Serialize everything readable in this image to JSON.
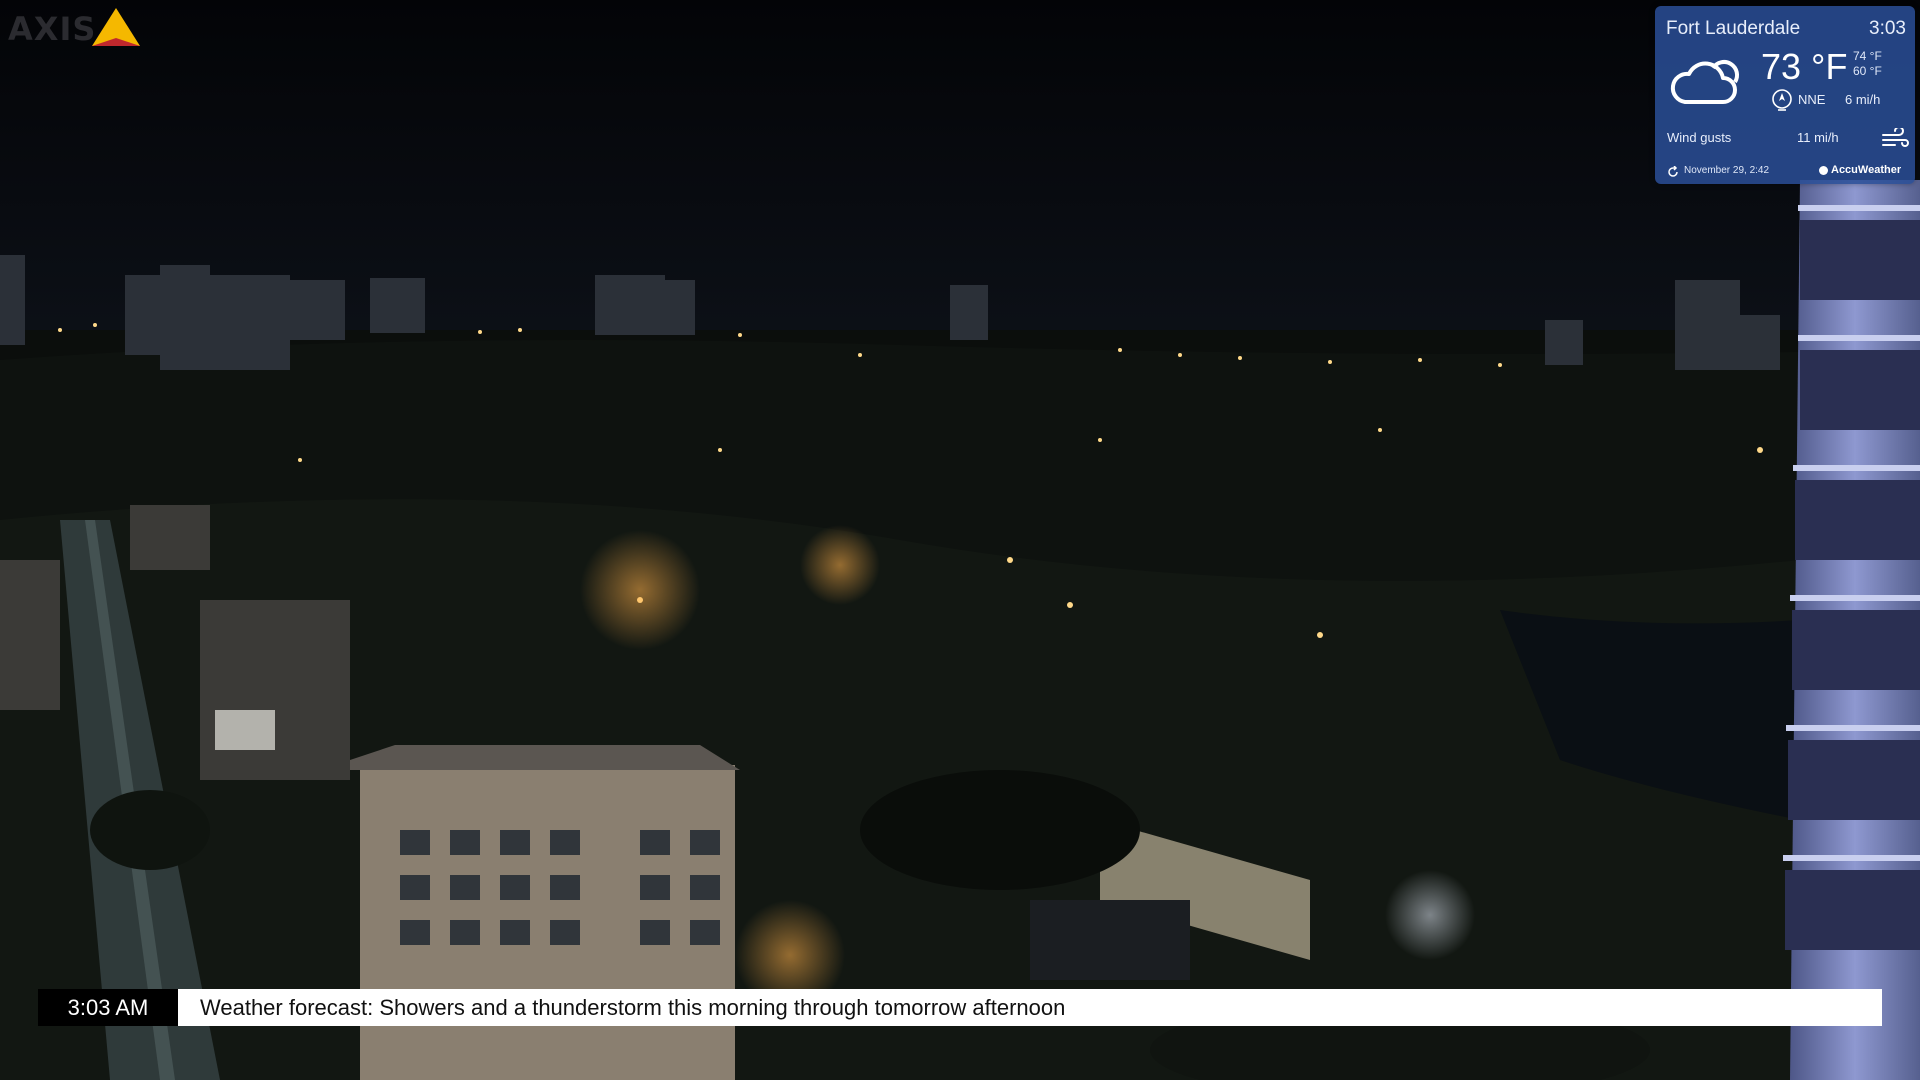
{
  "overlay": {
    "logo_text": "AXIS",
    "brand_color": "#f5b800"
  },
  "weather": {
    "city": "Fort Lauderdale",
    "time": "3:03",
    "temperature": "73 °F",
    "high": "74 °F",
    "low": "60 °F",
    "wind_direction": "NNE",
    "wind_speed": "6 mi/h",
    "gusts_label": "Wind gusts",
    "gusts_value": "11 mi/h",
    "updated": "November 29, 2:42",
    "provider": "AccuWeather",
    "condition_icon": "cloud-icon",
    "panel_color": "#2a4e96"
  },
  "ticker": {
    "time": "3:03 AM",
    "message": "Weather forecast: Showers and a thunderstorm this morning through tomorrow afternoon"
  }
}
